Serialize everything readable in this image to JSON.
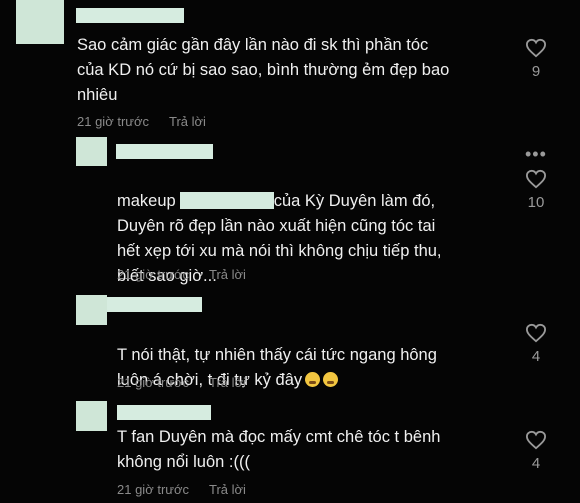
{
  "comments": [
    {
      "text": "Sao cảm giác gần đây lần nào đi sk thì phần tóc\ncủa KD nó cứ bị sao sao, bình thường ẻm đẹp bao\nnhiêu",
      "time": "21 giờ trước",
      "reply": "Trả lời",
      "likes": "9"
    },
    {
      "text_prefix": "makeup",
      "text_suffix": "của Kỳ Duyên làm đó,",
      "text_rest": "Duyên rõ đẹp lần nào xuất hiện cũng tóc tai\nhết xẹp tới xu mà nói thì không chịu tiếp thu,\nbiết sao giờ...",
      "time": "21 giờ trước",
      "reply": "Trả lời",
      "likes": "10"
    },
    {
      "text": "T nói thật, tự nhiên thấy cái tức ngang hông\nluôn á chời, t đi tự kỷ đây",
      "emoji": "confounded-face-icon",
      "time": "21 giờ trước",
      "reply": "Trả lời",
      "likes": "4"
    },
    {
      "text": "T fan Duyên mà đọc mấy cmt chê tóc t bênh\nkhông nổi luôn :(((",
      "time": "21 giờ trước",
      "reply": "Trả lời",
      "likes": "4"
    }
  ],
  "icons": {
    "like": "heart-outline-icon",
    "more": "more-dots-icon"
  },
  "colors": {
    "background": "#050505",
    "redaction": "#d4ebdf",
    "text": "#f0f0f0",
    "meta": "#8a8a8a"
  }
}
